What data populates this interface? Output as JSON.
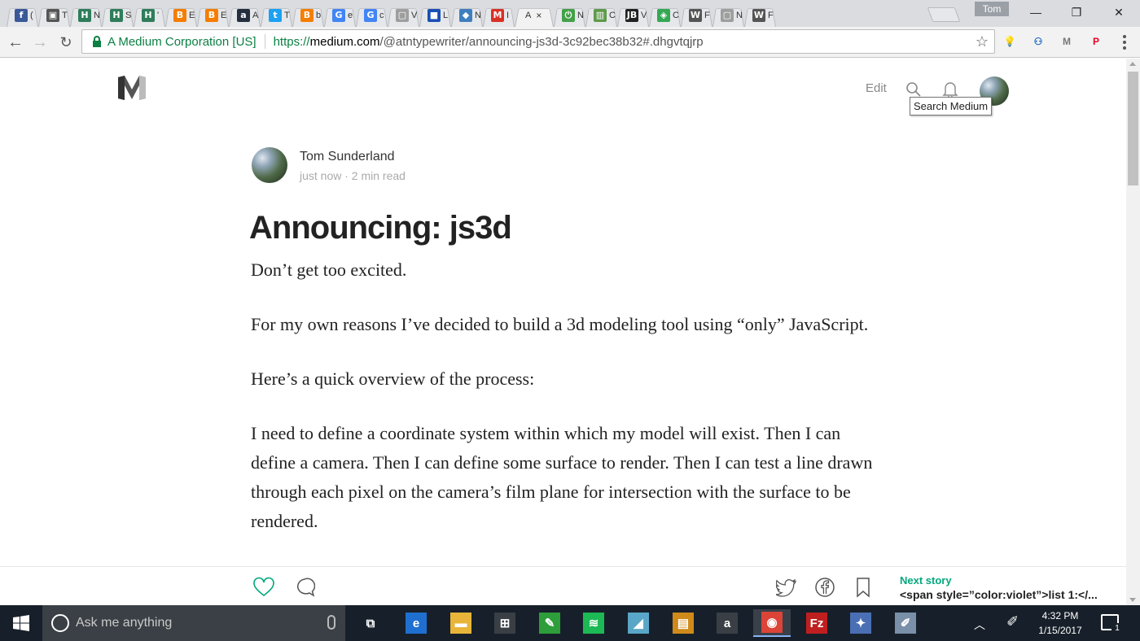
{
  "browser": {
    "tabs": [
      {
        "letter": "f",
        "label": "(",
        "color": "#3b5998"
      },
      {
        "letter": "▣",
        "label": "T",
        "color": "#555555"
      },
      {
        "letter": "H",
        "label": "N",
        "color": "#2f7d5a"
      },
      {
        "letter": "H",
        "label": "S",
        "color": "#2f7d5a"
      },
      {
        "letter": "H",
        "label": "'",
        "color": "#2f7d5a"
      },
      {
        "letter": "B",
        "label": "E",
        "color": "#f57d00"
      },
      {
        "letter": "B",
        "label": "E",
        "color": "#f57d00"
      },
      {
        "letter": "a",
        "label": "A",
        "color": "#232f3e"
      },
      {
        "letter": "t",
        "label": "T",
        "color": "#1da1f2"
      },
      {
        "letter": "B",
        "label": "b",
        "color": "#f57d00"
      },
      {
        "letter": "G",
        "label": "e",
        "color": "#4285f4"
      },
      {
        "letter": "G",
        "label": "c",
        "color": "#4285f4"
      },
      {
        "letter": "▢",
        "label": "V",
        "color": "#9e9e9e"
      },
      {
        "letter": "■",
        "label": "L",
        "color": "#1a4fb4"
      },
      {
        "letter": "◆",
        "label": "N",
        "color": "#3f7fbf"
      },
      {
        "letter": "M",
        "label": "I",
        "color": "#d93025"
      },
      {
        "letter": "",
        "label": "A",
        "color": "#f2f2f2",
        "active": true
      },
      {
        "letter": "⏻",
        "label": "N",
        "color": "#43a047"
      },
      {
        "letter": "▥",
        "label": "C",
        "color": "#5d9a4a"
      },
      {
        "letter": "JB",
        "label": "V",
        "color": "#222222"
      },
      {
        "letter": "◈",
        "label": "C",
        "color": "#34a853"
      },
      {
        "letter": "W",
        "label": "F",
        "color": "#555555"
      },
      {
        "letter": "▢",
        "label": "N",
        "color": "#9e9e9e"
      },
      {
        "letter": "W",
        "label": "F",
        "color": "#555555"
      }
    ],
    "active_tab_close": "×",
    "profile_name": "Tom",
    "window_controls": {
      "minimize": "—",
      "restore": "❐",
      "close": "✕"
    },
    "security_label": "A Medium Corporation [US]",
    "url_scheme": "https://",
    "url_host": "medium.com",
    "url_path": "/@atntypewriter/announcing-js3d-3c92bec38b32#.dhgvtqjrp",
    "extensions": [
      {
        "name": "lightbulb-extension-icon",
        "glyph": "💡",
        "color": "#333333"
      },
      {
        "name": "password-extension-icon",
        "glyph": "⚇",
        "color": "#1565c0"
      },
      {
        "name": "gmail-checker-icon",
        "glyph": "M",
        "color": "#777777"
      },
      {
        "name": "pinterest-icon",
        "glyph": "P",
        "color": "#e60023"
      }
    ],
    "gmail_badge": "?"
  },
  "page": {
    "top_nav": {
      "edit_label": "Edit",
      "search_tooltip": "Search Medium"
    },
    "author": {
      "name": "Tom Sunderland",
      "meta": "just now · 2 min read"
    },
    "post": {
      "title": "Announcing: js3d",
      "paragraphs": [
        "Don’t get too excited.",
        "For my own reasons I’ve decided to build a 3d modeling tool using “only” JavaScript.",
        "Here’s a quick overview of the process:",
        "I need to define a coordinate system within which my model will exist. Then I can define a camera. Then I can define some surface to render. Then I can test a line drawn through each pixel on the camera’s film plane for intersection with the surface to be rendered."
      ]
    },
    "bottom_bar": {
      "next_story_label": "Next story",
      "next_story_title": "<span style=”color:violet”>list 1:</..."
    }
  },
  "taskbar": {
    "search_placeholder": "Ask me anything",
    "apps": [
      {
        "name": "task-view-button",
        "glyph": "⧉",
        "bg": "transparent"
      },
      {
        "name": "edge-app",
        "glyph": "e",
        "bg": "#1f6fd1"
      },
      {
        "name": "file-explorer-app",
        "glyph": "▬",
        "bg": "#e8b53a"
      },
      {
        "name": "store-app",
        "glyph": "⊞",
        "bg": "#3a3f45"
      },
      {
        "name": "green-app",
        "glyph": "✎",
        "bg": "#2e9e3a"
      },
      {
        "name": "spotify-app",
        "glyph": "≋",
        "bg": "#1db954"
      },
      {
        "name": "drive-app",
        "glyph": "◢",
        "bg": "#5aa6c8"
      },
      {
        "name": "notes-app",
        "glyph": "▤",
        "bg": "#d08a1a"
      },
      {
        "name": "amazon-app",
        "glyph": "a",
        "bg": "#3a3f45"
      },
      {
        "name": "chrome-app",
        "glyph": "◉",
        "bg": "#db4437",
        "active": true
      },
      {
        "name": "filezilla-app",
        "glyph": "Fz",
        "bg": "#bf1f1f"
      },
      {
        "name": "chart-app",
        "glyph": "✦",
        "bg": "#4a6fb5"
      },
      {
        "name": "paint-app",
        "glyph": "✐",
        "bg": "#7a8fa8"
      }
    ],
    "time": "4:32 PM",
    "date": "1/15/2017",
    "notification_count": "1"
  }
}
